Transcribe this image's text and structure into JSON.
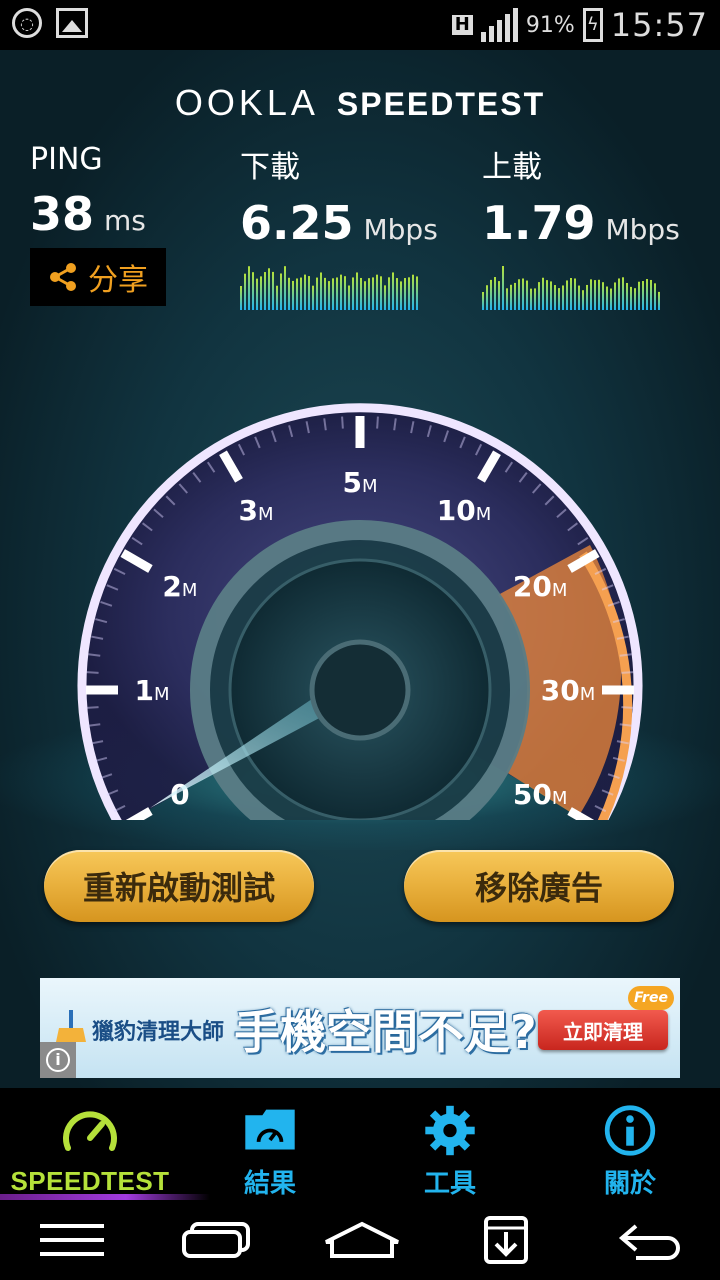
{
  "status_bar": {
    "network": "H",
    "battery": "91%",
    "time": "15:57",
    "icons": [
      "data-saver-icon",
      "image-icon",
      "network-h-icon",
      "signal-icon",
      "battery-charging-icon"
    ]
  },
  "header": {
    "brand": "OOKLA",
    "product": "SPEEDTEST"
  },
  "results": {
    "ping": {
      "label": "PING",
      "value": "38",
      "unit": "ms"
    },
    "download": {
      "label": "下載",
      "value": "6.25",
      "unit": "Mbps"
    },
    "upload": {
      "label": "上載",
      "value": "1.79",
      "unit": "Mbps"
    },
    "share_label": "分享"
  },
  "gauge": {
    "ticks": [
      "0",
      "1",
      "2",
      "3",
      "5",
      "10",
      "20",
      "30",
      "50"
    ],
    "unit_suffix": "M",
    "needle_value": "0",
    "accent_colors": {
      "ring": "#c9a6ff",
      "orange_zone": "#f08a3a",
      "needle": "#9feaf5"
    }
  },
  "actions": {
    "restart_label": "重新啟動測試",
    "remove_ads_label": "移除廣告"
  },
  "ad": {
    "brand": "獵豹清理大師",
    "headline": "手機空間不足?",
    "cta": "立即清理",
    "badge": "Free"
  },
  "tabs": [
    {
      "label": "SPEEDTEST",
      "icon": "speedometer-icon",
      "active": true
    },
    {
      "label": "結果",
      "icon": "folder-gauge-icon",
      "active": false
    },
    {
      "label": "工具",
      "icon": "gear-icon",
      "active": false
    },
    {
      "label": "關於",
      "icon": "info-icon",
      "active": false
    }
  ],
  "nav": [
    "menu-icon",
    "recent-apps-icon",
    "home-icon",
    "download-box-icon",
    "back-icon"
  ],
  "colors": {
    "accent_green": "#b5e13a",
    "accent_blue": "#22b4ee",
    "share_orange": "#f0a020"
  }
}
